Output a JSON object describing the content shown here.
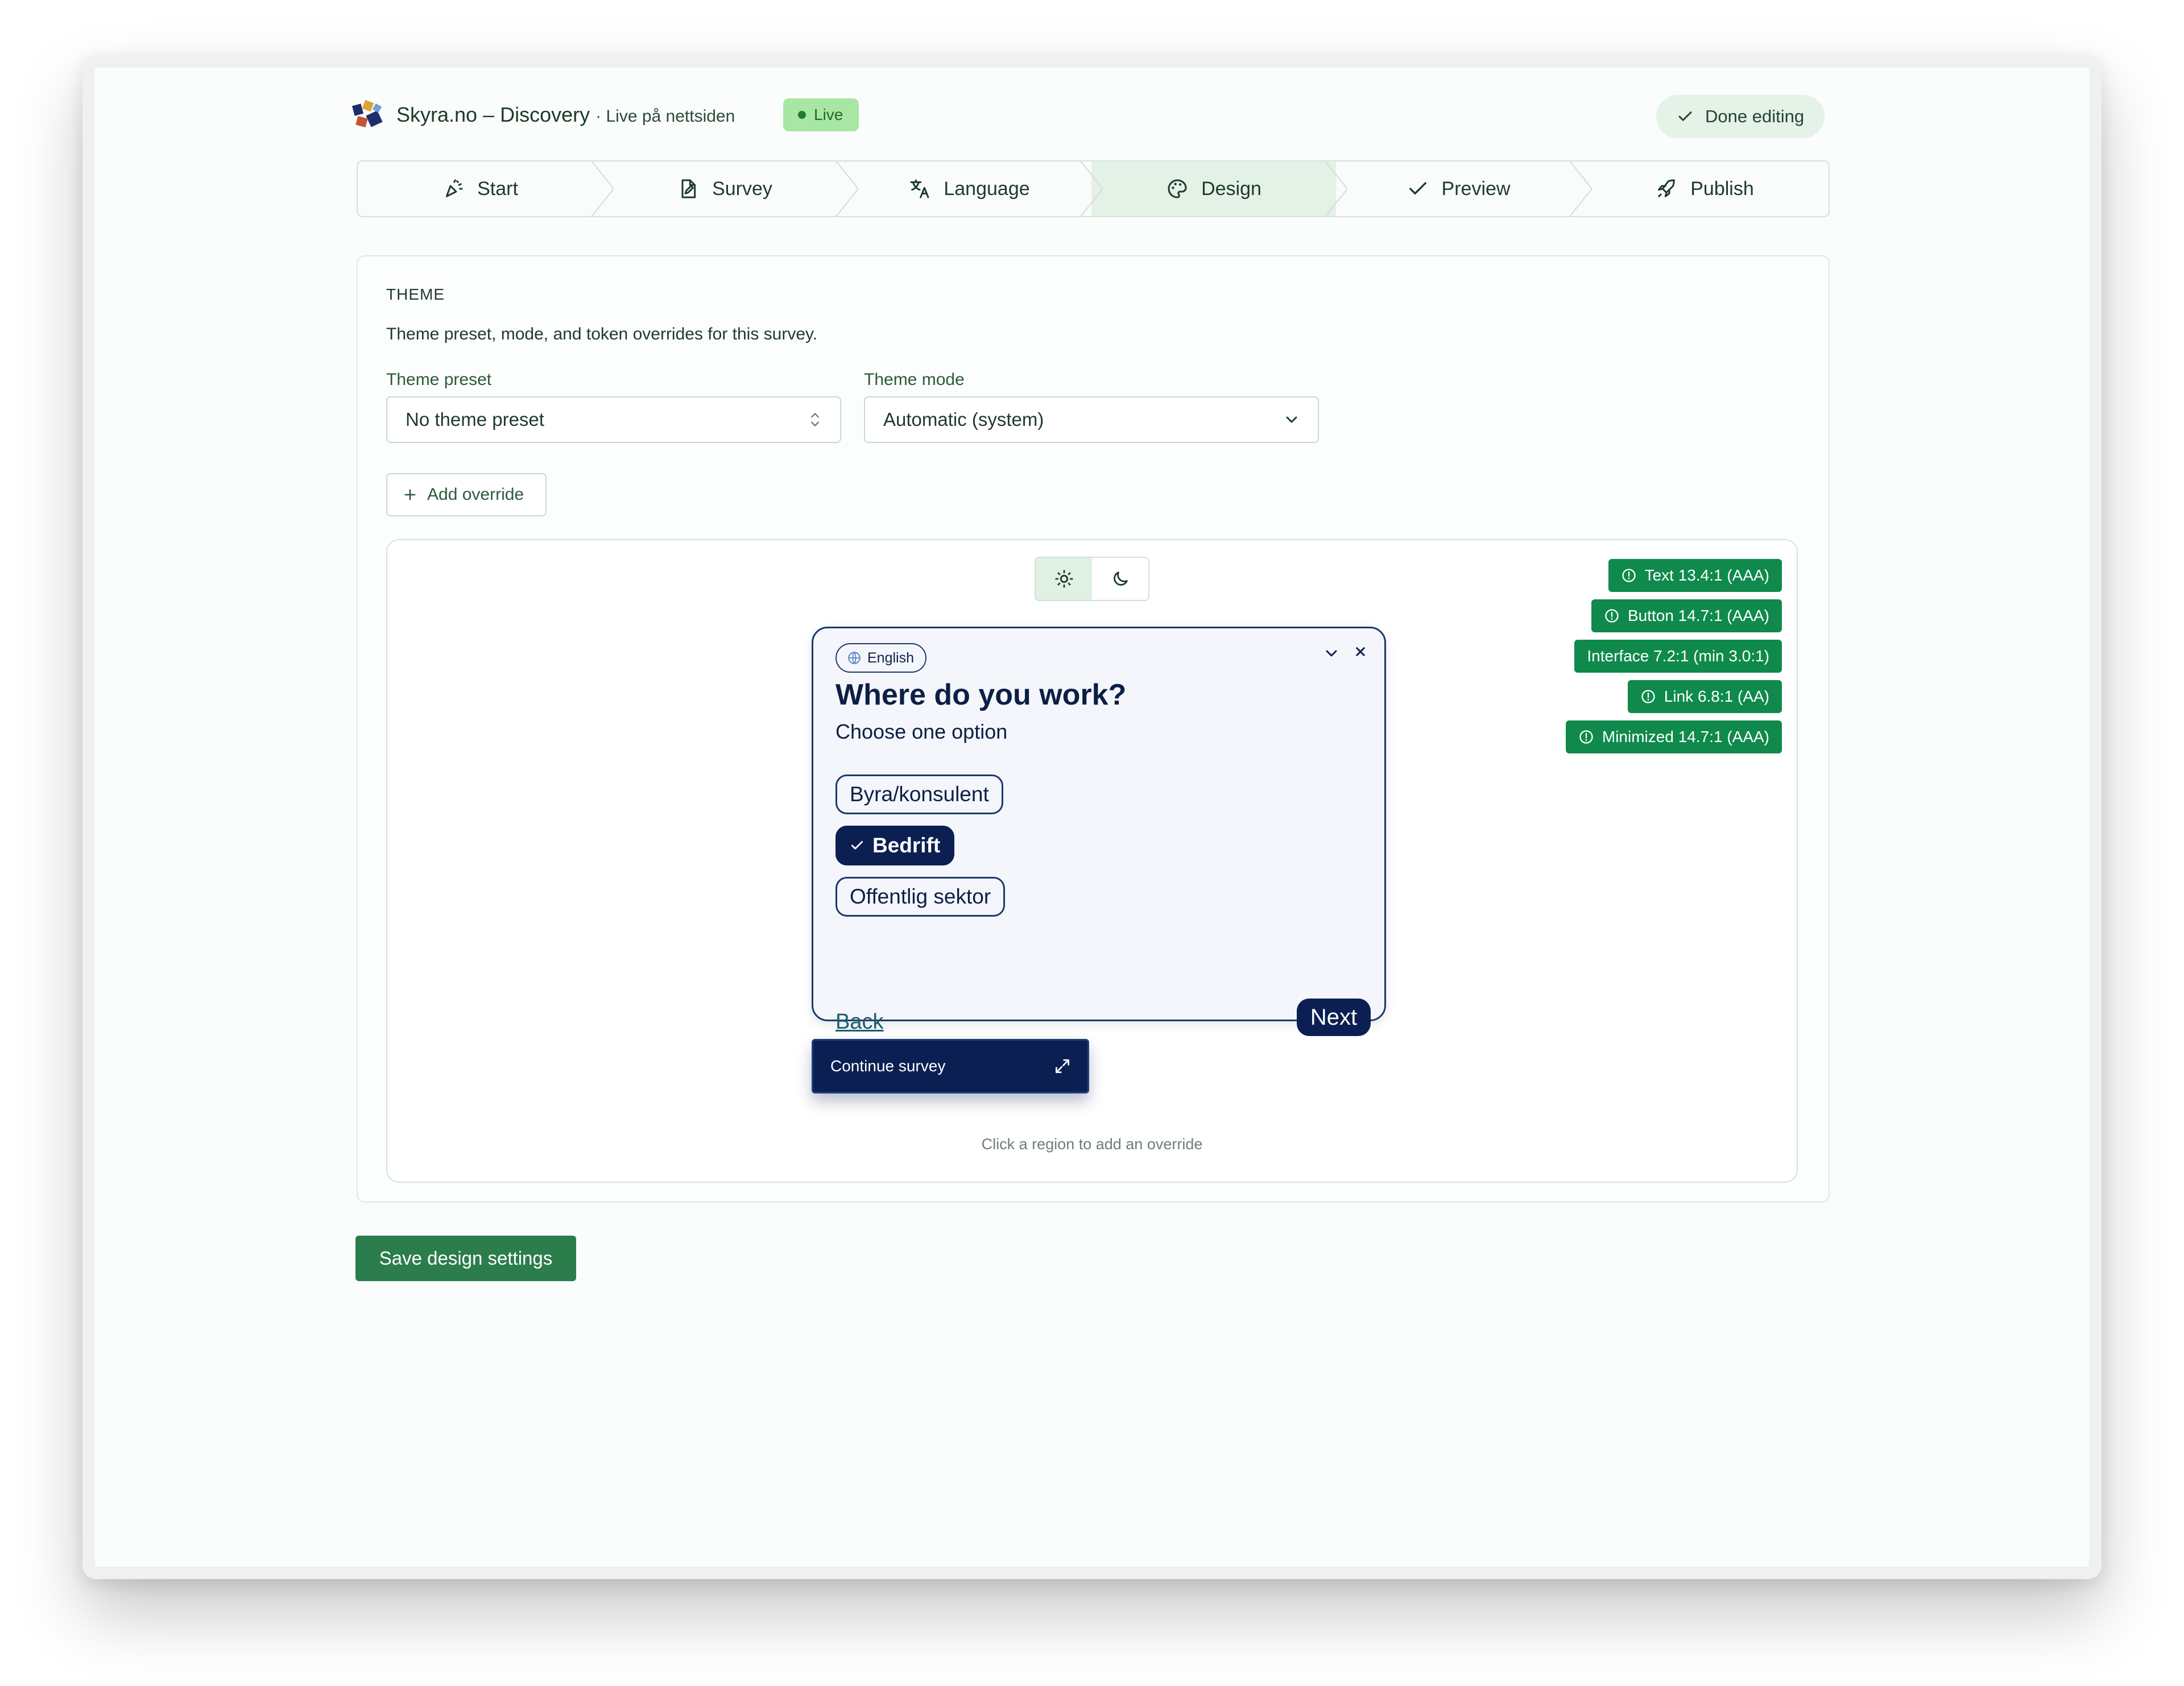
{
  "header": {
    "title": "Skyra.no – Discovery",
    "subtitle": "· Live på nettsiden",
    "live_badge": "Live",
    "done_label": "Done editing"
  },
  "steps": [
    {
      "label": "Start",
      "icon": "party-popper-icon"
    },
    {
      "label": "Survey",
      "icon": "file-edit-icon"
    },
    {
      "label": "Language",
      "icon": "translate-icon"
    },
    {
      "label": "Design",
      "icon": "palette-icon",
      "active": true
    },
    {
      "label": "Preview",
      "icon": "check-icon"
    },
    {
      "label": "Publish",
      "icon": "rocket-icon"
    }
  ],
  "theme": {
    "section_label": "THEME",
    "description": "Theme preset, mode, and token overrides for this survey.",
    "preset_label": "Theme preset",
    "preset_value": "No theme preset",
    "mode_label": "Theme mode",
    "mode_value": "Automatic (system)",
    "add_override": "Add override"
  },
  "contrast_badges": [
    {
      "label": "Text 13.4:1 (AAA)",
      "icon": "info-circle-icon"
    },
    {
      "label": "Button 14.7:1 (AAA)",
      "icon": "info-circle-icon"
    },
    {
      "label": "Interface 7.2:1 (min 3.0:1)",
      "icon": ""
    },
    {
      "label": "Link 6.8:1 (AA)",
      "icon": "info-circle-icon"
    },
    {
      "label": "Minimized 14.7:1 (AAA)",
      "icon": "info-circle-icon"
    }
  ],
  "widget": {
    "language": "English",
    "question": "Where do you work?",
    "instruction": "Choose one option",
    "options": [
      {
        "label": "Byra/konsulent",
        "selected": false
      },
      {
        "label": "Bedrift",
        "selected": true
      },
      {
        "label": "Offentlig sektor",
        "selected": false
      }
    ],
    "back": "Back",
    "next": "Next",
    "continue": "Continue survey"
  },
  "preview_hint": "Click a region to add an override",
  "save_label": "Save design settings",
  "colors": {
    "primary_green": "#2c7d4c",
    "badge_green": "#0f8a4c",
    "survey_navy": "#0b1f52",
    "live_badge_bg": "#a8e6a3"
  }
}
